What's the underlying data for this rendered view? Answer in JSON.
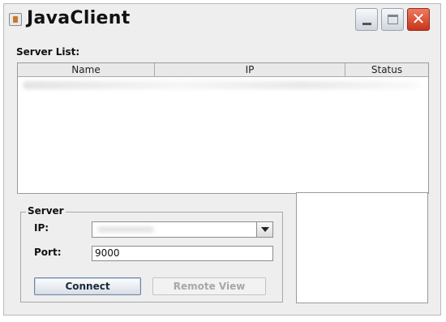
{
  "window": {
    "title": "JavaClient",
    "controls": [
      "minimize-icon",
      "maximize-icon",
      "close-icon"
    ]
  },
  "server_list": {
    "label": "Server List:",
    "columns": [
      "Name",
      "IP",
      "Status"
    ]
  },
  "server_group": {
    "title": "Server",
    "ip_label": "IP:",
    "port_label": "Port:",
    "port_value": "9000",
    "connect_label": "Connect",
    "remote_view_label": "Remote View"
  },
  "colors": {
    "close_button": "#c8341a",
    "disabled_text": "#a7a7a7"
  }
}
